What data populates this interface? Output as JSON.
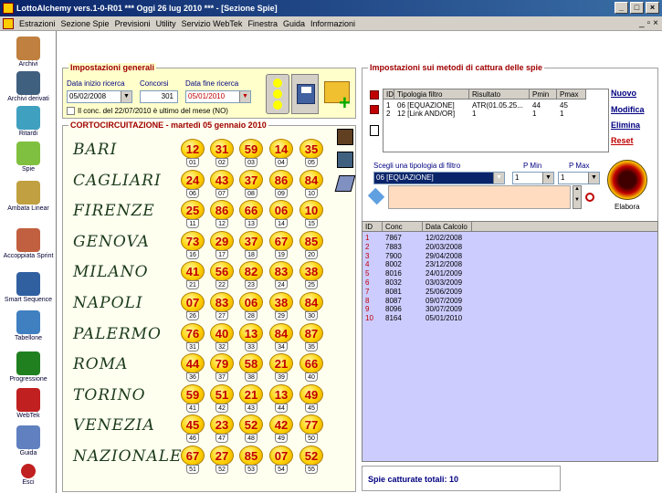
{
  "window": {
    "title": "LottoAlchemy vers.1-0-R01   ***   Oggi 26 lug 2010   ***   - [Sezione Spie]"
  },
  "menu": [
    "Estrazioni",
    "Sezione Spie",
    "Previsioni",
    "Utility",
    "Servizio WebTek",
    "Finestra",
    "Guida",
    "Informazioni"
  ],
  "sidebar": [
    {
      "label": "Archivi",
      "icon": "pencil-icon"
    },
    {
      "label": "Archivi derivati",
      "icon": "book-icon"
    },
    {
      "label": "Ritardi",
      "icon": "clock-icon"
    },
    {
      "label": "Spie",
      "icon": "flashlight-icon"
    },
    {
      "label": "Ambata Linear",
      "icon": "letter-a-icon"
    },
    {
      "label": "Accoppiata Sprint",
      "icon": "arrows-icon"
    },
    {
      "label": "Smart Sequence",
      "icon": "shield-icon"
    },
    {
      "label": "Tabellone",
      "icon": "calendar-icon"
    },
    {
      "label": "Progressione",
      "icon": "dollar-icon"
    },
    {
      "label": "WebTek",
      "icon": "webtek-icon"
    },
    {
      "label": "Guida",
      "icon": "guide-icon"
    },
    {
      "label": "Esci",
      "icon": "exit-icon"
    }
  ],
  "settings": {
    "title": "Impostazioni generali",
    "start_label": "Data inizio ricerca",
    "start_value": "05/02/2008",
    "concorsi_label": "Concorsi",
    "concorsi_value": "301",
    "end_label": "Data fine ricerca",
    "end_value": "05/01/2010",
    "checkbox_label": "Il conc. del 22/07/2010 è ultimo del mese (NO)"
  },
  "draw": {
    "title": "CORTOCIRCUITAZIONE - martedì 05 gennaio 2010",
    "wheels": [
      {
        "name": "BARI",
        "numbers": [
          "12",
          "31",
          "59",
          "14",
          "35"
        ],
        "positions": [
          "01",
          "02",
          "03",
          "04",
          "05"
        ]
      },
      {
        "name": "CAGLIARI",
        "numbers": [
          "24",
          "43",
          "37",
          "86",
          "84"
        ],
        "positions": [
          "06",
          "07",
          "08",
          "09",
          "10"
        ]
      },
      {
        "name": "FIRENZE",
        "numbers": [
          "25",
          "86",
          "66",
          "06",
          "10"
        ],
        "positions": [
          "11",
          "12",
          "13",
          "14",
          "15"
        ]
      },
      {
        "name": "GENOVA",
        "numbers": [
          "73",
          "29",
          "37",
          "67",
          "85"
        ],
        "positions": [
          "16",
          "17",
          "18",
          "19",
          "20"
        ]
      },
      {
        "name": "MILANO",
        "numbers": [
          "41",
          "56",
          "82",
          "83",
          "38"
        ],
        "positions": [
          "21",
          "22",
          "23",
          "24",
          "25"
        ]
      },
      {
        "name": "NAPOLI",
        "numbers": [
          "07",
          "83",
          "06",
          "38",
          "84"
        ],
        "positions": [
          "26",
          "27",
          "28",
          "29",
          "30"
        ]
      },
      {
        "name": "PALERMO",
        "numbers": [
          "76",
          "40",
          "13",
          "84",
          "87"
        ],
        "positions": [
          "31",
          "32",
          "33",
          "34",
          "35"
        ]
      },
      {
        "name": "ROMA",
        "numbers": [
          "44",
          "79",
          "58",
          "21",
          "66"
        ],
        "positions": [
          "36",
          "37",
          "38",
          "39",
          "40"
        ]
      },
      {
        "name": "TORINO",
        "numbers": [
          "59",
          "51",
          "21",
          "13",
          "49"
        ],
        "positions": [
          "41",
          "42",
          "43",
          "44",
          "45"
        ]
      },
      {
        "name": "VENEZIA",
        "numbers": [
          "45",
          "23",
          "52",
          "42",
          "77"
        ],
        "positions": [
          "46",
          "47",
          "48",
          "49",
          "50"
        ]
      },
      {
        "name": "NAZIONALE",
        "numbers": [
          "67",
          "27",
          "85",
          "07",
          "52"
        ],
        "positions": [
          "51",
          "52",
          "53",
          "54",
          "55"
        ]
      }
    ]
  },
  "methods": {
    "title": "Impostazioni sui metodi di cattura delle spie",
    "columns": [
      "ID",
      "Tipologia filtro",
      "Risultato",
      "Pmin",
      "Pmax"
    ],
    "rows": [
      [
        "1",
        "06 [EQUAZIONE]",
        "ATR(01.05.25...",
        "44",
        "45"
      ],
      [
        "2",
        "12 [Link AND/OR]",
        "1",
        "1",
        "1"
      ]
    ],
    "links": [
      "Nuovo",
      "Modifica",
      "Elimina",
      "Reset"
    ],
    "filter_label": "Scegli una tipologia di filtro",
    "filter_value": "06 [EQUAZIONE]",
    "pmin_label": "P Min",
    "pmin_value": "1",
    "pmax_label": "P Max",
    "pmax_value": "1",
    "elabora_label": "Elabora"
  },
  "results": {
    "columns": [
      "ID",
      "Conc",
      "Data Calcolo"
    ],
    "rows": [
      [
        "1",
        "7867",
        "12/02/2008"
      ],
      [
        "2",
        "7883",
        "20/03/2008"
      ],
      [
        "3",
        "7900",
        "29/04/2008"
      ],
      [
        "4",
        "8002",
        "23/12/2008"
      ],
      [
        "5",
        "8016",
        "24/01/2009"
      ],
      [
        "6",
        "8032",
        "03/03/2009"
      ],
      [
        "7",
        "8081",
        "25/06/2009"
      ],
      [
        "8",
        "8087",
        "09/07/2009"
      ],
      [
        "9",
        "8096",
        "30/07/2009"
      ],
      [
        "10",
        "8164",
        "05/01/2010"
      ]
    ],
    "total": "Spie catturate totali: 10"
  },
  "colors": {
    "accent": "#a00000",
    "settings_bg": "#ffffcc",
    "grid_bg": "#ccccff",
    "bulb": "#ffd000"
  }
}
